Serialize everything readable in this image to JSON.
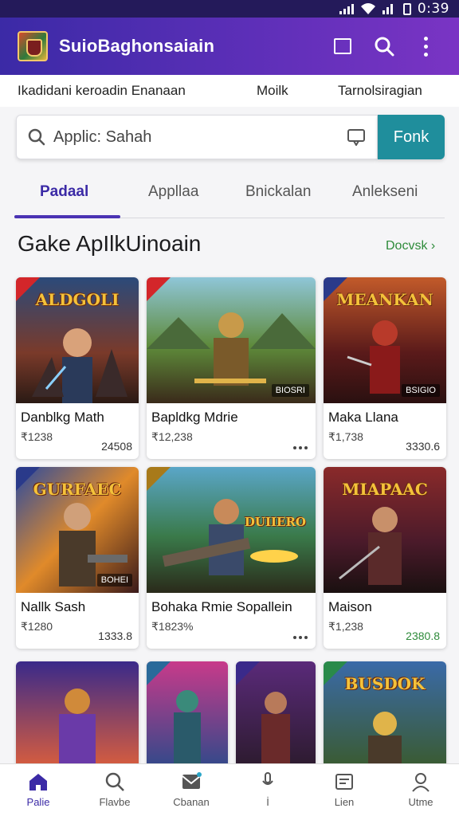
{
  "status_bar": {
    "time": "0:39"
  },
  "app_bar": {
    "title": "SuioBaghonsaiain"
  },
  "info_strip": {
    "left": "Ikadidani keroadin Enanaan",
    "middle": "Moilk",
    "right": "Tarnolsiragian"
  },
  "search": {
    "placeholder": "Applic: Sahah",
    "button_label": "Fonk"
  },
  "tabs": [
    {
      "label": "Padaal",
      "active": true
    },
    {
      "label": "Appllaa",
      "active": false
    },
    {
      "label": "Bnickalan",
      "active": false
    },
    {
      "label": "Anlekseni",
      "active": false
    }
  ],
  "section": {
    "title": "Gake ApIlkUinoain",
    "see_more": "Docvsk ›"
  },
  "cards": [
    {
      "name": "Danblkg Math",
      "price": "₹1238",
      "count": "24508",
      "thumb_title": "ALDGOLI",
      "thumb_tag": ""
    },
    {
      "name": "Bapldkg Mdrie",
      "price": "₹12,238",
      "count": "",
      "thumb_title": "",
      "thumb_tag": "BIOSRI"
    },
    {
      "name": "Maka Llana",
      "price": "₹1,738",
      "count": "3330.6",
      "thumb_title": "MEANKAN",
      "thumb_tag": "BSIGIO"
    },
    {
      "name": "Nallk Sash",
      "price": "₹1280",
      "count": "1333.8",
      "thumb_title": "GURFAEC",
      "thumb_tag": "BOHEI"
    },
    {
      "name": "Bohaka Rmie Sopallein",
      "price": "₹1823%",
      "count": "",
      "thumb_title": "DUIIERO",
      "thumb_tag": ""
    },
    {
      "name": "Maison",
      "price": "₹1,238",
      "count": "2380.8",
      "thumb_title": "MIAPAAC",
      "thumb_tag": ""
    },
    {
      "name": "",
      "price": "",
      "count": "",
      "thumb_title": "",
      "thumb_tag": ""
    },
    {
      "name": "",
      "price": "",
      "count": "",
      "thumb_title": "",
      "thumb_tag": ""
    },
    {
      "name": "",
      "price": "",
      "count": "",
      "thumb_title": "",
      "thumb_tag": ""
    },
    {
      "name": "",
      "price": "",
      "count": "",
      "thumb_title": "BUSDOK",
      "thumb_tag": ""
    }
  ],
  "bottom_nav": [
    {
      "label": "Palie",
      "icon": "home-icon",
      "active": true
    },
    {
      "label": "Flavbe",
      "icon": "search-icon",
      "active": false
    },
    {
      "label": "Cbanan",
      "icon": "message-icon",
      "active": false
    },
    {
      "label": "İ",
      "icon": "mic-icon",
      "active": false
    },
    {
      "label": "Lien",
      "icon": "list-icon",
      "active": false
    },
    {
      "label": "Utme",
      "icon": "profile-icon",
      "active": false
    }
  ],
  "colors": {
    "app_bar_start": "#3b2aa6",
    "app_bar_end": "#7a34c4",
    "accent": "#1f8e9c",
    "green": "#2e8b3a"
  }
}
